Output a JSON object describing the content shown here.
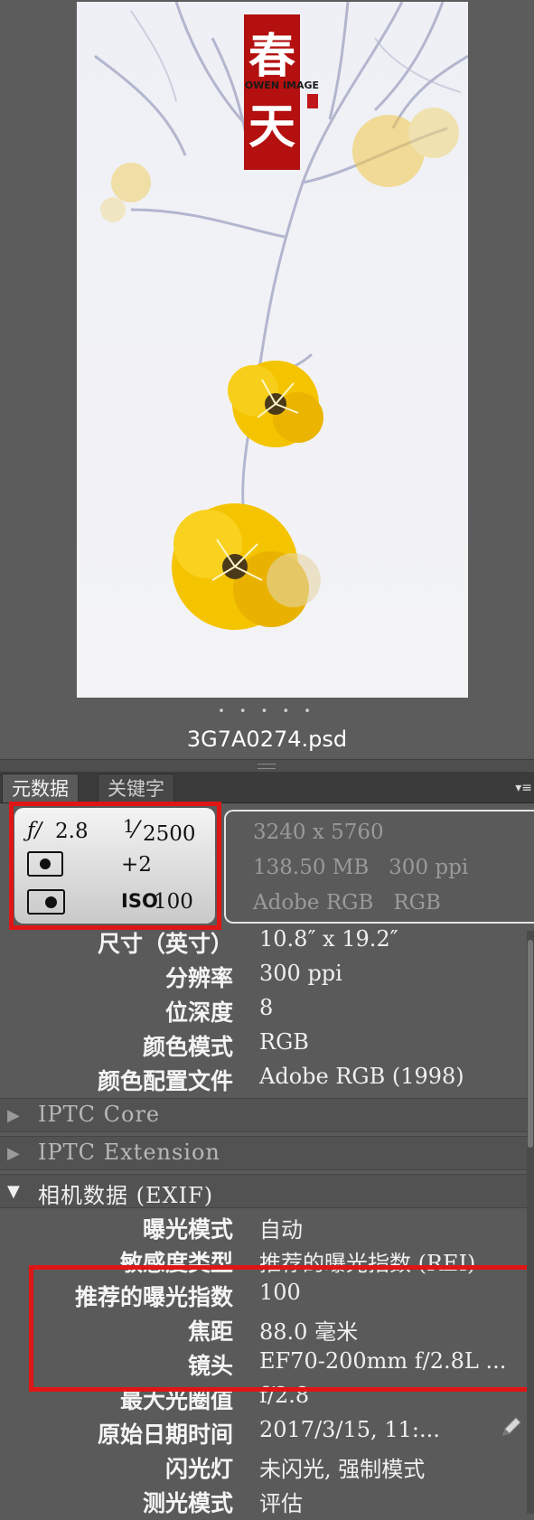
{
  "preview": {
    "logo_text": "OWEN IMAGE",
    "logo_chars": "春天",
    "filename": "3G7A0274.psd",
    "page_dots": "• • • • •"
  },
  "tabs": [
    {
      "label": "元数据",
      "active": true
    },
    {
      "label": "关键字",
      "active": false
    }
  ],
  "exposure": {
    "aperture_symbol": "ƒ/",
    "aperture": "2.8",
    "shutter_num": "1",
    "shutter_den": "2500",
    "exposure_comp": "+2",
    "iso_label": "ISO",
    "iso": "100"
  },
  "file_info": {
    "dimensions": "3240 x 5760",
    "size_ppi": "138.50 MB   300 ppi",
    "color": "Adobe RGB   RGB"
  },
  "file_props": [
    {
      "label": "尺寸（英寸）",
      "value": "10.8″ x 19.2″"
    },
    {
      "label": "分辨率",
      "value": "300 ppi"
    },
    {
      "label": "位深度",
      "value": "8"
    },
    {
      "label": "颜色模式",
      "value": "RGB"
    },
    {
      "label": "颜色配置文件",
      "value": "Adobe RGB (1998)"
    }
  ],
  "sections": [
    {
      "title": "IPTC Core",
      "open": false
    },
    {
      "title": "IPTC Extension",
      "open": false
    },
    {
      "title": "相机数据 (EXIF)",
      "open": true
    }
  ],
  "exif": [
    {
      "label": "曝光模式",
      "value": "自动"
    },
    {
      "label": "敏感度类型",
      "value": "推荐的曝光指数 (REI)"
    },
    {
      "label": "推荐的曝光指数",
      "value": "100"
    },
    {
      "label": "焦距",
      "value": "88.0 毫米"
    },
    {
      "label": "镜头",
      "value": "EF70-200mm f/2.8L ..."
    },
    {
      "label": "最大光圈值",
      "value": "f/2.8"
    },
    {
      "label": "原始日期时间",
      "value": "2017/3/15, 11:..."
    },
    {
      "label": "闪光灯",
      "value": "未闪光, 强制模式"
    },
    {
      "label": "测光模式",
      "value": "评估"
    }
  ],
  "icons": {
    "pencil": "pencil-icon",
    "panel_menu": "panel-menu-icon",
    "collapse": "triangle-right-icon",
    "expand": "triangle-down-icon"
  },
  "colors": {
    "highlight": "#e01515",
    "panel": "#5a5a5a",
    "flower": "#f5c400",
    "logo_red": "#b3100f"
  }
}
